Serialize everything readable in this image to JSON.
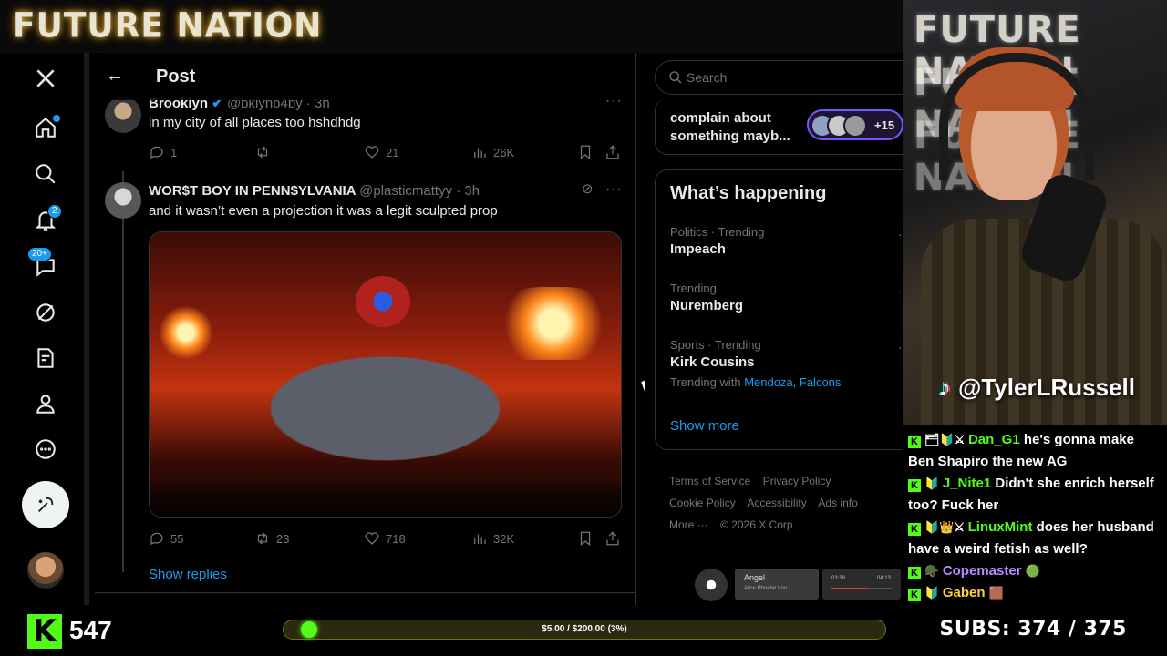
{
  "overlay": {
    "brand": "FUTURE NATION",
    "cam_brand": "FUTURE NATION",
    "tiktok_handle": "@TylerLRussell",
    "followers": "547",
    "goal_text": "$5.00 / $200.00 (3%)",
    "goal_progress": 0.03,
    "subs": "SUBS:  374 / 375",
    "kick_color": "#53fc18"
  },
  "leftnav": {
    "items": [
      {
        "icon": "x-logo-icon"
      },
      {
        "icon": "home-icon"
      },
      {
        "icon": "search-icon"
      },
      {
        "icon": "bell-icon",
        "badge": "2"
      },
      {
        "icon": "message-icon",
        "badge": "20+"
      },
      {
        "icon": "grok-icon"
      },
      {
        "icon": "drafts-icon"
      },
      {
        "icon": "profile-icon"
      },
      {
        "icon": "more-icon"
      }
    ]
  },
  "timeline": {
    "title": "Post",
    "tweets": [
      {
        "name": "Brooklyn",
        "handle": "@bklynb4by · 3h",
        "text": "in my city of all places too hshdhdg",
        "replies": "1",
        "retweets": "",
        "likes": "21",
        "views": "26K"
      },
      {
        "name": "WOR$T BOY IN PENN$YLVANIA",
        "handle": "@plasticmattyy · 3h",
        "text": "and it wasn’t even a projection it was a legit sculpted prop",
        "replies": "55",
        "retweets": "23",
        "likes": "718",
        "views": "32K"
      }
    ],
    "show_replies": "Show replies"
  },
  "sidebar": {
    "search_placeholder": "Search",
    "spaces_text": "complain about something mayb...",
    "spaces_count": "+15",
    "trends_title": "What’s happening",
    "trends": [
      {
        "context": "Politics · Trending",
        "name": "Impeach"
      },
      {
        "context": "Trending",
        "name": "Nuremberg"
      },
      {
        "context": "Sports · Trending",
        "name": "Kirk Cousins",
        "with_label": "Trending with",
        "with_links": "Mendoza, Falcons"
      }
    ],
    "show_more": "Show more",
    "footer": {
      "terms": "Terms of Service",
      "privacy": "Privacy Policy",
      "cookie": "Cookie Policy",
      "accessibility": "Accessibility",
      "ads": "Ads info",
      "more": "More ···",
      "copyright": "© 2026 X Corp."
    }
  },
  "chat": {
    "messages": [
      {
        "user": "Dan_G1",
        "color": "#53fc18",
        "text": "he's gonna make Ben Shapiro the new AG"
      },
      {
        "user": "J_Nite1",
        "color": "#53fc18",
        "text": "Didn't she enrich herself too? Fuck her"
      },
      {
        "user": "LinuxMint",
        "color": "#53fc18",
        "text": "does her husband have a weird fetish as well?"
      },
      {
        "user": "Copemaster",
        "color": "#b48cff",
        "text": ""
      },
      {
        "user": "Gaben",
        "color": "#ffd23a",
        "text": ""
      }
    ]
  },
  "music": {
    "title": "Angel",
    "artist": "Alice Phoebe Lou",
    "elapsed": "03:38",
    "total": "04:13"
  }
}
